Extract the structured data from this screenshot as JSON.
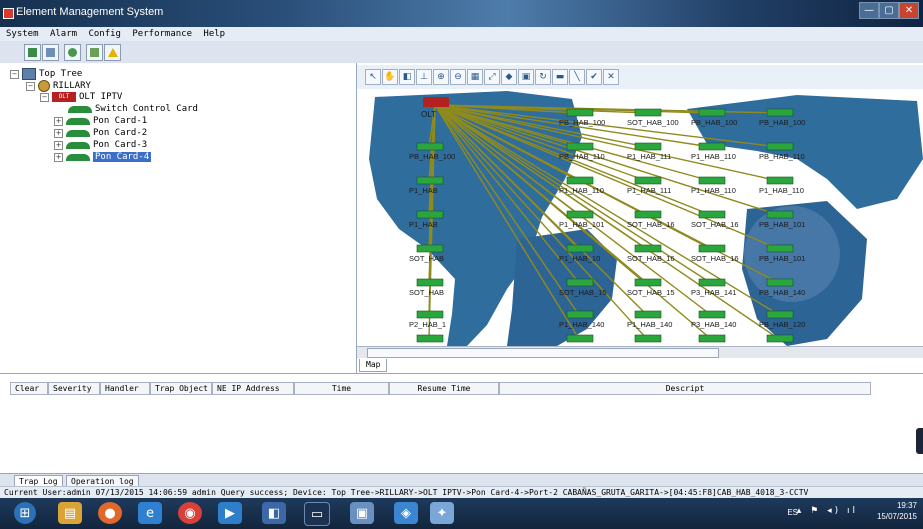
{
  "window": {
    "title": "Element Management System",
    "controls": [
      "—",
      "▢",
      "✕"
    ]
  },
  "menu": [
    "System",
    "Alarm",
    "Config",
    "Performance",
    "Help"
  ],
  "toolbar_icons": [
    "topology-icon",
    "device-icon",
    "settings-icon",
    "config-icon",
    "alarm-warning-icon"
  ],
  "tree": {
    "root": "Top Tree",
    "site": "RILLARY",
    "olt_tag": "OLT",
    "olt": "OLT IPTV",
    "switch": "Switch Control Card",
    "cards": [
      "Pon Card-1",
      "Pon Card-2",
      "Pon Card-3",
      "Pon Card-4"
    ]
  },
  "map": {
    "tab": "Map",
    "olt_label": "OLT",
    "onus": [
      {
        "label": "PB_HAB_100",
        "col": 2,
        "row": 0
      },
      {
        "label": "SOT_HAB_100",
        "col": 3,
        "row": 0
      },
      {
        "label": "PB_HAB_100",
        "col": 4,
        "row": 0
      },
      {
        "label": "PB_HAB_100",
        "col": 5,
        "row": 0
      },
      {
        "label": "PB_HAB_100",
        "col": 0,
        "row": 1
      },
      {
        "label": "PB_HAB_110",
        "col": 2,
        "row": 1
      },
      {
        "label": "P1_HAB_111",
        "col": 3,
        "row": 1
      },
      {
        "label": "P1_HAB_110",
        "col": 4,
        "row": 1
      },
      {
        "label": "PB_HAB_110",
        "col": 5,
        "row": 1
      },
      {
        "label": "P1_HAB",
        "col": 0,
        "row": 2
      },
      {
        "label": "P1_HAB_110",
        "col": 2,
        "row": 2
      },
      {
        "label": "P1_HAB_111",
        "col": 3,
        "row": 2
      },
      {
        "label": "P1_HAB_110",
        "col": 4,
        "row": 2
      },
      {
        "label": "P1_HAB_110",
        "col": 5,
        "row": 2
      },
      {
        "label": "P1_HAB",
        "col": 0,
        "row": 3
      },
      {
        "label": "P1_HAB_101",
        "col": 2,
        "row": 3
      },
      {
        "label": "SOT_HAB_16",
        "col": 3,
        "row": 3
      },
      {
        "label": "SOT_HAB_16",
        "col": 4,
        "row": 3
      },
      {
        "label": "PB_HAB_101",
        "col": 5,
        "row": 3
      },
      {
        "label": "SOT_HAB",
        "col": 0,
        "row": 4
      },
      {
        "label": "P1_HAB_10",
        "col": 2,
        "row": 4
      },
      {
        "label": "SOT_HAB_16",
        "col": 3,
        "row": 4
      },
      {
        "label": "SOT_HAB_16",
        "col": 4,
        "row": 4
      },
      {
        "label": "PB_HAB_101",
        "col": 5,
        "row": 4
      },
      {
        "label": "SOT_HAB",
        "col": 0,
        "row": 5
      },
      {
        "label": "SOT_HAB_15",
        "col": 2,
        "row": 5
      },
      {
        "label": "SOT_HAB_15",
        "col": 3,
        "row": 5
      },
      {
        "label": "P3_HAB_141",
        "col": 4,
        "row": 5
      },
      {
        "label": "PB_HAB_140",
        "col": 5,
        "row": 5
      },
      {
        "label": "P2_HAB_1",
        "col": 0,
        "row": 6
      },
      {
        "label": "P1_HAB_140",
        "col": 2,
        "row": 6
      },
      {
        "label": "P1_HAB_140",
        "col": 3,
        "row": 6
      },
      {
        "label": "P3_HAB_140",
        "col": 4,
        "row": 6
      },
      {
        "label": "PB_HAB_120",
        "col": 5,
        "row": 6
      },
      {
        "label": "",
        "col": 0,
        "row": 7
      },
      {
        "label": "",
        "col": 2,
        "row": 7
      },
      {
        "label": "",
        "col": 3,
        "row": 7
      },
      {
        "label": "",
        "col": 4,
        "row": 7
      },
      {
        "label": "",
        "col": 5,
        "row": 7
      }
    ]
  },
  "map_tools": [
    "select-icon",
    "hand-icon",
    "fit-icon",
    "layout-icon",
    "zoom-in-icon",
    "zoom-out-icon",
    "grid-icon",
    "expand-icon",
    "tag-icon",
    "save-icon",
    "refresh-icon",
    "monitor-icon",
    "line-icon",
    "ok-icon",
    "close-icon"
  ],
  "trap_columns": [
    "Clear",
    "Severity",
    "Handler",
    "Trap Object",
    "NE IP Address",
    "Time",
    "Resume Time",
    "Descript"
  ],
  "bottom_tabs": [
    "Trap Log",
    "Operation log"
  ],
  "status": "Current User:admin   07/13/2015 14:06:59  admin  Query  success; Device: Top Tree->RILLARY->OLT IPTV->Pon Card-4->Port-2 CABAÑAS_GRUTA_GARITA->[04:45:F8]CAB_HAB_4018_3-CCTV",
  "taskbar": {
    "lang": "ES",
    "time": "19:37",
    "date": "15/07/2015",
    "apps": [
      "windows-start-icon",
      "file-explorer-icon",
      "firefox-icon",
      "internet-explorer-icon",
      "chrome-icon",
      "media-icon",
      "app-icon",
      "terminal-icon",
      "window-icon",
      "network-icon",
      "app2-icon"
    ]
  }
}
